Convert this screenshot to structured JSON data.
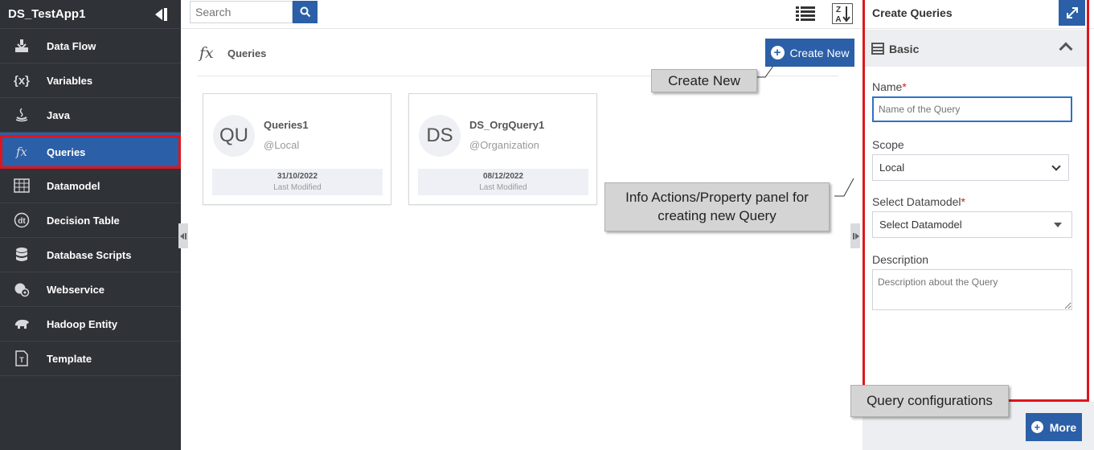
{
  "app": {
    "title": "DS_TestApp1"
  },
  "sidebar": {
    "items": [
      {
        "label": "Data Flow",
        "icon": "data-flow-icon",
        "active": false
      },
      {
        "label": "Variables",
        "icon": "variables-icon",
        "active": false
      },
      {
        "label": "Java",
        "icon": "java-icon",
        "active": false
      },
      {
        "label": "Queries",
        "icon": "fx-icon",
        "active": true
      },
      {
        "label": "Datamodel",
        "icon": "table-icon",
        "active": false
      },
      {
        "label": "Decision Table",
        "icon": "decision-table-icon",
        "active": false
      },
      {
        "label": "Database Scripts",
        "icon": "database-icon",
        "active": false
      },
      {
        "label": "Webservice",
        "icon": "webservice-icon",
        "active": false
      },
      {
        "label": "Hadoop Entity",
        "icon": "hadoop-icon",
        "active": false
      },
      {
        "label": "Template",
        "icon": "template-icon",
        "active": false
      }
    ],
    "glyphs": {
      "variables": "{x}",
      "fx": "fx"
    }
  },
  "search": {
    "placeholder": "Search"
  },
  "main": {
    "title": "Queries",
    "create_label": "Create New",
    "cards": [
      {
        "initials": "QU",
        "name": "Queries1",
        "scope": "@Local",
        "date": "31/10/2022",
        "date_label": "Last Modified"
      },
      {
        "initials": "DS",
        "name": "DS_OrgQuery1",
        "scope": "@Organization",
        "date": "08/12/2022",
        "date_label": "Last Modified"
      }
    ]
  },
  "callouts": {
    "create_new": "Create New",
    "info_panel": "Info Actions/Property panel for creating new Query",
    "query_config": "Query configurations"
  },
  "panel": {
    "title": "Create Queries",
    "section": "Basic",
    "name_label": "Name",
    "name_placeholder": "Name of the Query",
    "scope_label": "Scope",
    "scope_value": "Local",
    "datamodel_label": "Select Datamodel",
    "datamodel_value": "Select Datamodel",
    "description_label": "Description",
    "description_placeholder": "Description about the Query",
    "more_label": "More",
    "required_mark": "*"
  },
  "colors": {
    "primary": "#2b5fa7",
    "sidebar": "#2f3237",
    "highlight": "#e0151b"
  }
}
